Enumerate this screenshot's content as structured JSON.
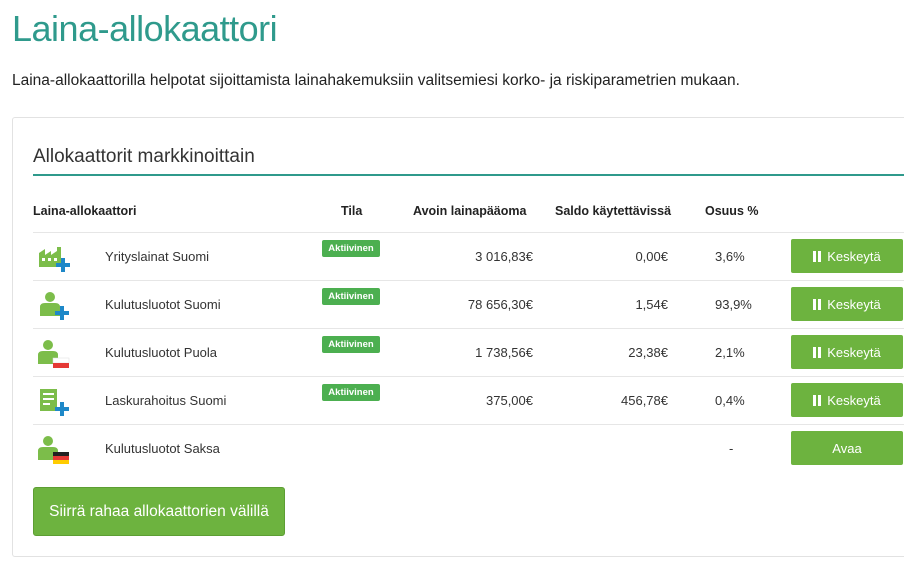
{
  "page": {
    "title": "Laina-allokaattori",
    "description": "Laina-allokaattorilla helpotat sijoittamista lainahakemuksiin valitsemiesi korko- ja riskiparametrien mukaan."
  },
  "panel": {
    "title": "Allokaattorit markkinoittain",
    "columns": {
      "name": "Laina-allokaattori",
      "status": "Tila",
      "open_principal": "Avoin lainapääoma",
      "balance": "Saldo käytettävissä",
      "share": "Osuus %"
    },
    "rows": [
      {
        "icon": "factory-plus-icon",
        "name": "Yrityslainat Suomi",
        "status": "Aktiivinen",
        "open_principal": "3 016,83€",
        "balance": "0,00€",
        "share": "3,6%",
        "action": "Keskeytä"
      },
      {
        "icon": "person-plus-icon",
        "name": "Kulutusluotot Suomi",
        "status": "Aktiivinen",
        "open_principal": "78 656,30€",
        "balance": "1,54€",
        "share": "93,9%",
        "action": "Keskeytä"
      },
      {
        "icon": "person-poland-flag-icon",
        "name": "Kulutusluotot Puola",
        "status": "Aktiivinen",
        "open_principal": "1 738,56€",
        "balance": "23,38€",
        "share": "2,1%",
        "action": "Keskeytä"
      },
      {
        "icon": "invoice-plus-icon",
        "name": "Laskurahoitus Suomi",
        "status": "Aktiivinen",
        "open_principal": "375,00€",
        "balance": "456,78€",
        "share": "0,4%",
        "action": "Keskeytä"
      },
      {
        "icon": "person-germany-flag-icon",
        "name": "Kulutusluotot Saksa",
        "status": "",
        "open_principal": "",
        "balance": "",
        "share": "-",
        "action": "Avaa"
      }
    ],
    "transfer_button": "Siirrä rahaa allokaattorien välillä"
  },
  "colors": {
    "accent": "#2f9a8c",
    "button_green": "#6db33f",
    "badge_green": "#4caf50",
    "icon_green": "#7cbd4a",
    "icon_blue": "#1e88c8",
    "flag_red": "#e53935"
  }
}
